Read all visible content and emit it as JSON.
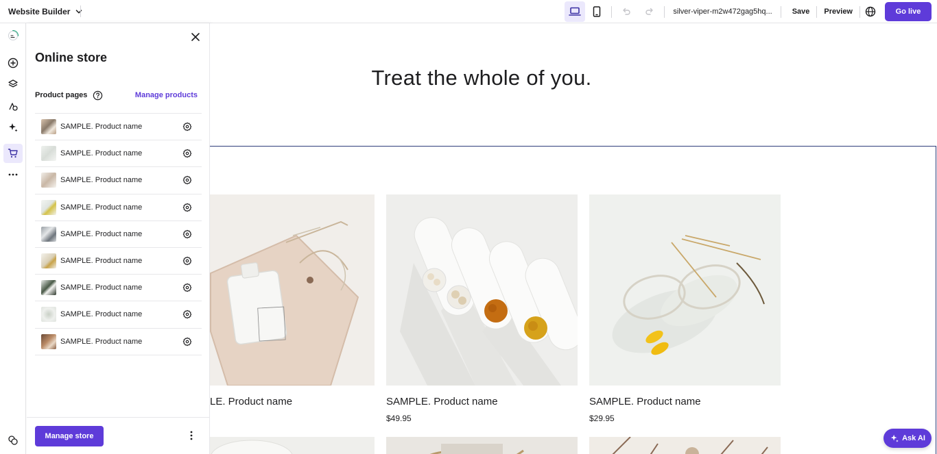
{
  "topbar": {
    "brand": "Website Builder",
    "site_url": "silver-viper-m2w472gag5hq...",
    "save_label": "Save",
    "preview_label": "Preview",
    "go_live_label": "Go live",
    "accent_color": "#5e3bd9"
  },
  "panel": {
    "title": "Online store",
    "product_pages_label": "Product pages",
    "manage_products_label": "Manage products",
    "products": [
      {
        "name": "SAMPLE. Product name"
      },
      {
        "name": "SAMPLE. Product name"
      },
      {
        "name": "SAMPLE. Product name"
      },
      {
        "name": "SAMPLE. Product name"
      },
      {
        "name": "SAMPLE. Product name"
      },
      {
        "name": "SAMPLE. Product name"
      },
      {
        "name": "SAMPLE. Product name"
      },
      {
        "name": "SAMPLE. Product name"
      },
      {
        "name": "SAMPLE. Product name"
      }
    ],
    "manage_store_label": "Manage store"
  },
  "canvas": {
    "hero_title": "Treat the whole of you.",
    "cards": [
      {
        "name": "LE. Product name",
        "price": ""
      },
      {
        "name": "SAMPLE. Product name",
        "price": "$49.95"
      },
      {
        "name": "SAMPLE. Product name",
        "price": "$29.95"
      }
    ]
  },
  "ask_ai_label": "Ask AI"
}
